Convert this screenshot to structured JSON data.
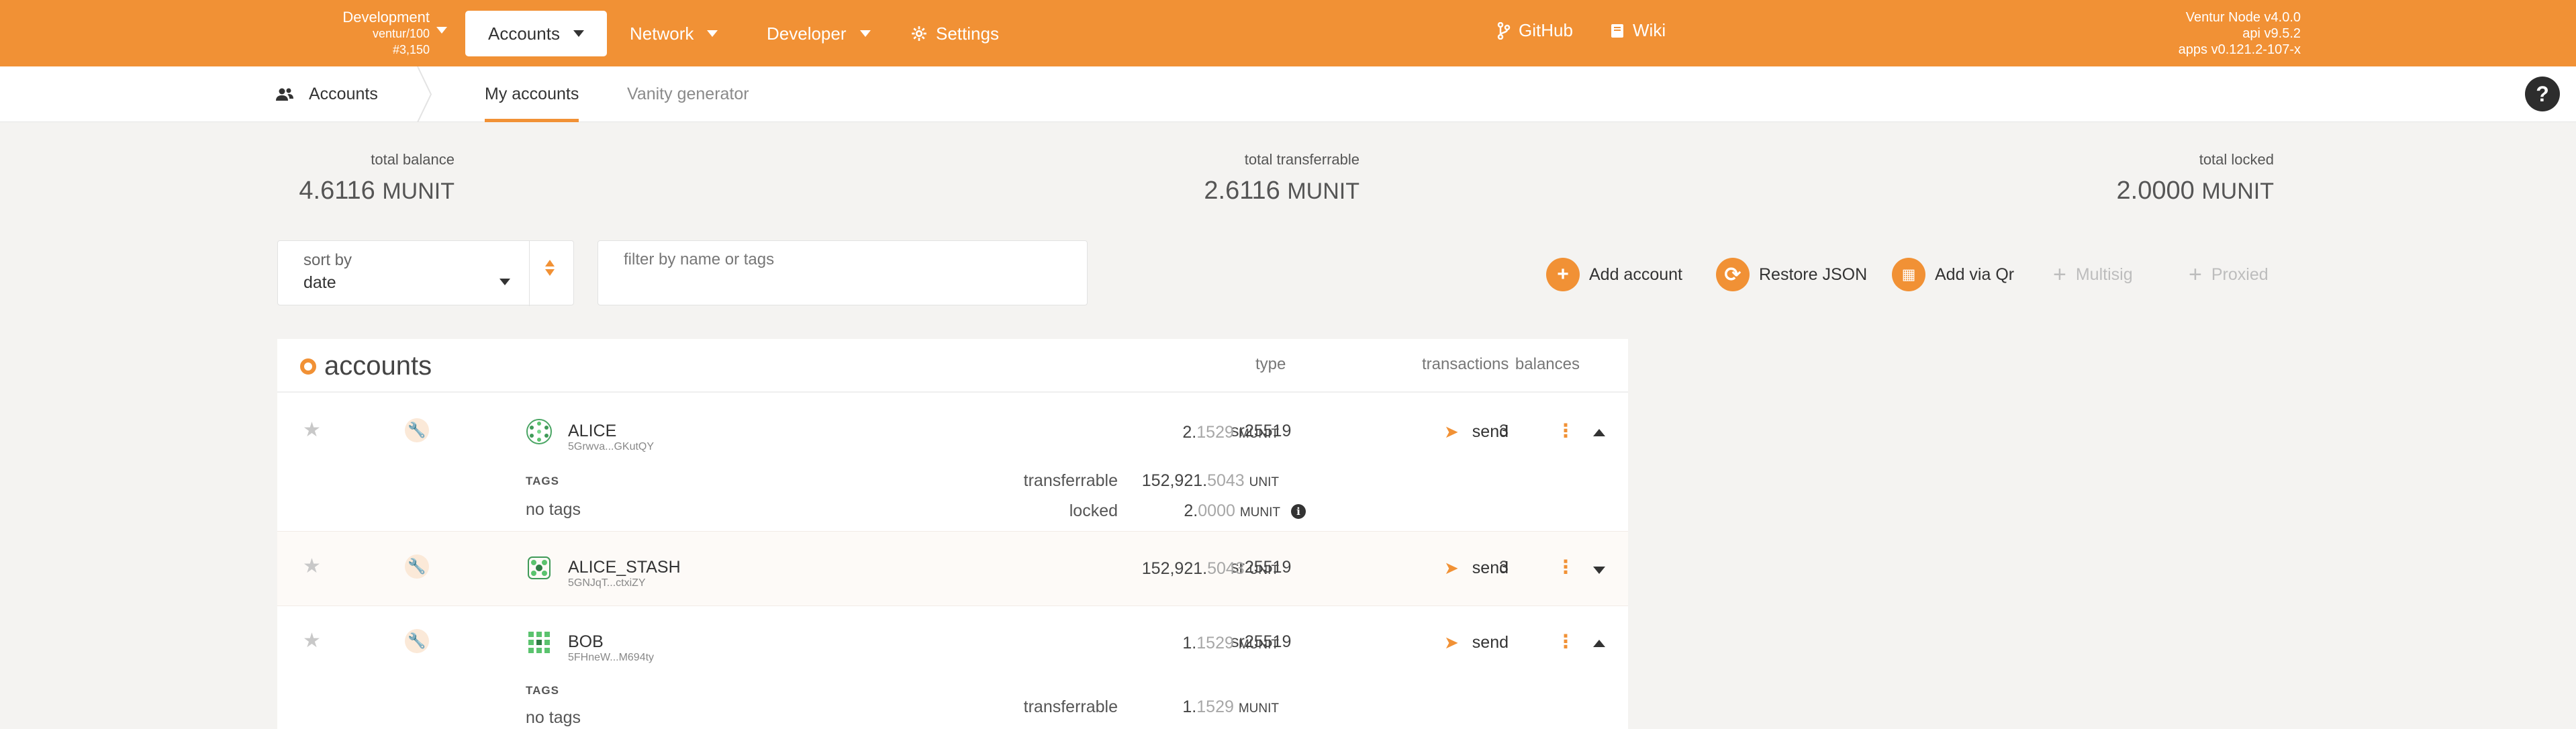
{
  "chain": {
    "name": "Development",
    "version": "ventur/100",
    "block": "#3,150"
  },
  "nav": {
    "accounts": "Accounts",
    "network": "Network",
    "developer": "Developer",
    "settings": "Settings",
    "github": "GitHub",
    "wiki": "Wiki"
  },
  "node": {
    "name": "Ventur Node v4.0.0",
    "api": "api v9.5.2",
    "apps": "apps v0.121.2-107-x"
  },
  "subnav": {
    "section": "Accounts",
    "tab_my_accounts": "My accounts",
    "tab_vanity": "Vanity generator",
    "help": "?"
  },
  "summary": {
    "total_balance_label": "total balance",
    "total_balance_value": "4.6116",
    "total_balance_unit": "MUNIT",
    "total_transferrable_label": "total transferrable",
    "total_transferrable_value": "2.6116",
    "total_transferrable_unit": "MUNIT",
    "total_locked_label": "total locked",
    "total_locked_value": "2.0000",
    "total_locked_unit": "MUNIT"
  },
  "sort": {
    "label": "sort by",
    "value": "date"
  },
  "filter": {
    "placeholder": "filter by name or tags",
    "value": ""
  },
  "actions": {
    "add_account": "Add account",
    "restore_json": "Restore JSON",
    "add_via_qr": "Add via Qr",
    "multisig": "Multisig",
    "proxied": "Proxied"
  },
  "table": {
    "title": "accounts",
    "col_type": "type",
    "col_transactions": "transactions",
    "col_balances": "balances",
    "tags_label": "TAGS",
    "no_tags": "no tags",
    "send_label": "send",
    "transferrable_label": "transferrable",
    "locked_label": "locked",
    "rows": [
      {
        "name": "ALICE",
        "address": "5Grwva...GKutQY",
        "type": "sr25519",
        "transactions": "3",
        "balance_int": "2.",
        "balance_dec": "1529",
        "balance_unit": "MUNIT",
        "transferrable_int": "152,921.",
        "transferrable_dec": "5043",
        "transferrable_unit": "UNIT",
        "locked_int": "2.",
        "locked_dec": "0000",
        "locked_unit": "MUNIT"
      },
      {
        "name": "ALICE_STASH",
        "address": "5GNJqT...ctxiZY",
        "type": "sr25519",
        "transactions": "3",
        "balance_int": "152,921.",
        "balance_dec": "5043",
        "balance_unit": "UNIT"
      },
      {
        "name": "BOB",
        "address": "5FHneW...M694ty",
        "type": "sr25519",
        "transactions": "",
        "balance_int": "1.",
        "balance_dec": "1529",
        "balance_unit": "MUNIT",
        "transferrable_int": "1.",
        "transferrable_dec": "1529",
        "transferrable_unit": "MUNIT"
      }
    ]
  },
  "colors": {
    "accent": "#f19135",
    "background": "#f4f3f1",
    "text": "#4e4e4e"
  }
}
